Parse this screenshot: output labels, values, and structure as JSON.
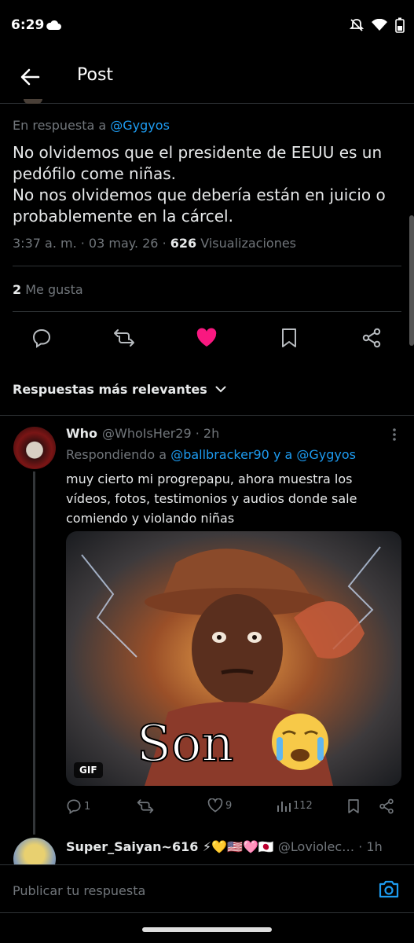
{
  "status": {
    "time": "6:29"
  },
  "header": {
    "title": "Post"
  },
  "post": {
    "reply_prefix": "En respuesta a",
    "reply_handle": "@Gygyos",
    "text_line1": "No olvidemos que el presidente de EEUU es un",
    "text_line2": "pedófilo come niñas.",
    "text_line3": "No nos olvidemos que debería están en juicio o",
    "text_line4": "probablemente en la cárcel.",
    "time": "3:37 a. m. · 03 may. 26 ·",
    "views_count": "626",
    "views_label": "Visualizaciones",
    "likes_count": "2",
    "likes_label": "Me gusta"
  },
  "sort": {
    "label": "Respuestas más relevantes"
  },
  "replies": [
    {
      "name": "Who",
      "handle_time": "@WhoIsHer29 · 2h",
      "replying_prefix": "Respondiendo a",
      "replying_handles": "@ballbracker90 y a @Gygyos",
      "text": "muy cierto mi progrepapu, ahora muestra los vídeos, fotos, testimonios y audios donde sale comiendo y violando niñas",
      "gif_caption": "Son",
      "gif_badge": "GIF",
      "replies_count": "1",
      "likes_count": "9",
      "views_count": "112"
    },
    {
      "name": "Super_Saiyan~616 ⚡💛🇺🇸🩷🇯🇵",
      "handle_time": "@Loviolec… · 1h"
    }
  ],
  "compose": {
    "placeholder": "Publicar tu respuesta"
  },
  "colors": {
    "accent": "#1d9bf0",
    "like": "#f91880",
    "bg": "#000000"
  }
}
